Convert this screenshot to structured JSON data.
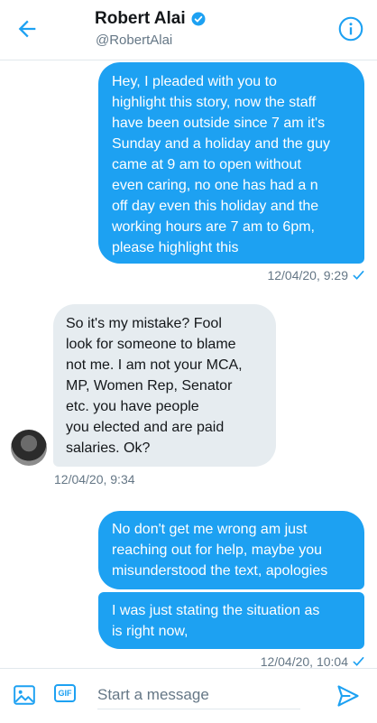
{
  "header": {
    "name": "Robert Alai",
    "handle": "@RobertAlai"
  },
  "messages": [
    {
      "direction": "sent",
      "text": "Hey, I pleaded with you to\nhighlight this story, now the staff\nhave been outside since 7 am it's\nSunday and a holiday and the guy\ncame at 9 am to open without\neven caring, no one has had a n\noff day even this holiday and the\nworking hours are 7 am to 6pm,\nplease highlight this",
      "timestamp": "12/04/20, 9:29"
    },
    {
      "direction": "received",
      "text": "So it's my mistake? Fool\nlook for someone to blame\nnot me. I am not your MCA,\nMP, Women Rep, Senator\netc. you have people\nyou elected and are paid\nsalaries. Ok?",
      "timestamp": "12/04/20, 9:34"
    },
    {
      "direction": "sent",
      "text": "No don't get me wrong am just\nreaching out for help, maybe you\nmisunderstood the text, apologies"
    },
    {
      "direction": "sent",
      "text": "I was just stating the situation as\nis right now,",
      "timestamp": "12/04/20, 10:04"
    }
  ],
  "composer": {
    "placeholder": "Start a message",
    "gif_label": "GIF"
  },
  "colors": {
    "accent": "#1da1f2",
    "received_bubble": "#e6ecf0",
    "muted_text": "#657786"
  }
}
